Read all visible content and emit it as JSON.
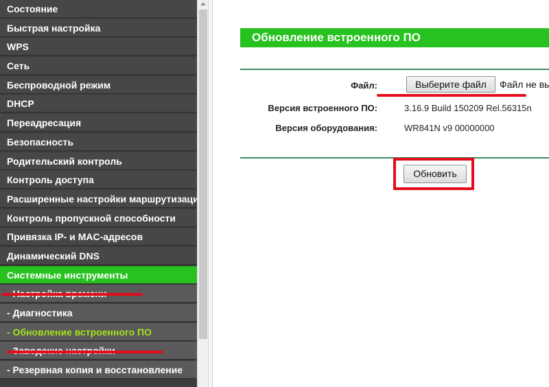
{
  "sidebar": {
    "items": [
      {
        "label": "Состояние",
        "type": "main"
      },
      {
        "label": "Быстрая настройка",
        "type": "main"
      },
      {
        "label": "WPS",
        "type": "main"
      },
      {
        "label": "Сеть",
        "type": "main"
      },
      {
        "label": "Беспроводной режим",
        "type": "main"
      },
      {
        "label": "DHCP",
        "type": "main"
      },
      {
        "label": "Переадресация",
        "type": "main"
      },
      {
        "label": "Безопасность",
        "type": "main"
      },
      {
        "label": "Родительский контроль",
        "type": "main"
      },
      {
        "label": "Контроль доступа",
        "type": "main"
      },
      {
        "label": "Расширенные настройки маршрутизации",
        "type": "main"
      },
      {
        "label": "Контроль пропускной способности",
        "type": "main"
      },
      {
        "label": "Привязка IP- и MAC-адресов",
        "type": "main"
      },
      {
        "label": "Динамический DNS",
        "type": "main"
      },
      {
        "label": "Системные инструменты",
        "type": "active"
      },
      {
        "label": "- Настройка времени",
        "type": "sub"
      },
      {
        "label": "- Диагностика",
        "type": "sub"
      },
      {
        "label": "- Обновление встроенного ПО",
        "type": "current"
      },
      {
        "label": "- Заводские настройки",
        "type": "sub"
      },
      {
        "label": "- Резервная копия и восстановление",
        "type": "sub"
      }
    ]
  },
  "main": {
    "title": "Обновление встроенного ПО",
    "file_label": "Файл:",
    "choose_file_button": "Выберите файл",
    "file_status": "Файл не выбран",
    "firmware_version_label": "Версия встроенного ПО:",
    "firmware_version_value": "3.16.9 Build 150209 Rel.56315n",
    "hardware_version_label": "Версия оборудования:",
    "hardware_version_value": "WR841N v9 00000000",
    "update_button": "Обновить"
  },
  "colors": {
    "accent_green": "#27c21f",
    "annotation_red": "#e30d1b",
    "current_item_text": "#a5e21b"
  }
}
